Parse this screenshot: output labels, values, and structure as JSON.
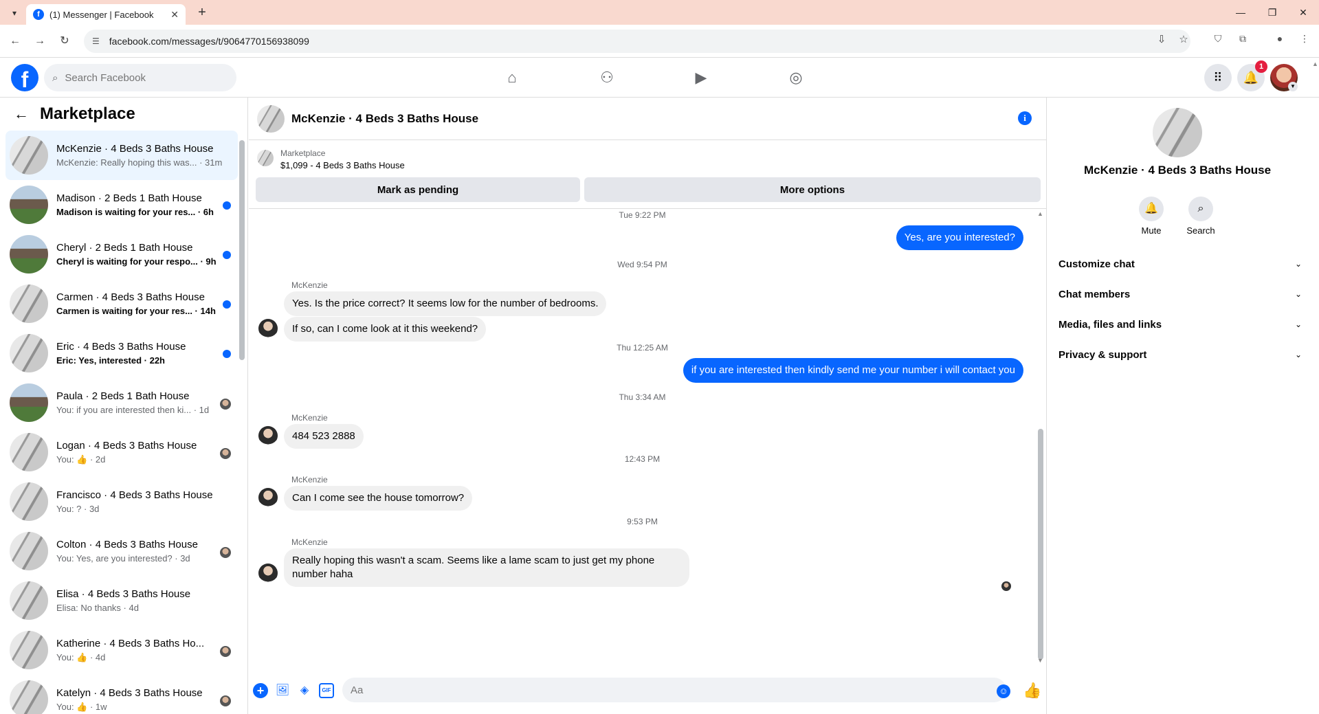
{
  "browser": {
    "tab_title": "(1) Messenger | Facebook",
    "url": "facebook.com/messages/t/9064770156938099"
  },
  "fb": {
    "search_placeholder": "Search Facebook",
    "notification_count": "1"
  },
  "sidebar": {
    "title": "Marketplace",
    "conversations": [
      {
        "name": "McKenzie · 4 Beds 3 Baths House",
        "snippet": "McKenzie: Really hoping this was... · 31m",
        "thumb": "h4",
        "active": true,
        "unread": false,
        "indicator": "none"
      },
      {
        "name": "Madison · 2 Beds 1 Bath House",
        "snippet": "Madison is waiting for your res... · 6h",
        "thumb": "h2",
        "active": false,
        "unread": true,
        "indicator": "dot"
      },
      {
        "name": "Cheryl · 2 Beds 1 Bath House",
        "snippet": "Cheryl is waiting for your respo... · 9h",
        "thumb": "h2",
        "active": false,
        "unread": true,
        "indicator": "dot"
      },
      {
        "name": "Carmen · 4 Beds 3 Baths House",
        "snippet": "Carmen is waiting for your res... · 14h",
        "thumb": "h4",
        "active": false,
        "unread": true,
        "indicator": "dot"
      },
      {
        "name": "Eric · 4 Beds 3 Baths House",
        "snippet": "Eric: Yes, interested · 22h",
        "thumb": "h4",
        "active": false,
        "unread": true,
        "indicator": "dot"
      },
      {
        "name": "Paula · 2 Beds 1 Bath House",
        "snippet": "You: if you are interested then ki... · 1d",
        "thumb": "h2",
        "active": false,
        "unread": false,
        "indicator": "seen"
      },
      {
        "name": "Logan · 4 Beds 3 Baths House",
        "snippet": "You: 👍 · 2d",
        "thumb": "h4",
        "active": false,
        "unread": false,
        "indicator": "seen"
      },
      {
        "name": "Francisco · 4 Beds 3 Baths House",
        "snippet": "You: ? · 3d",
        "thumb": "h4",
        "active": false,
        "unread": false,
        "indicator": "none"
      },
      {
        "name": "Colton · 4 Beds 3 Baths House",
        "snippet": "You: Yes, are you interested? · 3d",
        "thumb": "h4",
        "active": false,
        "unread": false,
        "indicator": "seen"
      },
      {
        "name": "Elisa · 4 Beds 3 Baths House",
        "snippet": "Elisa: No thanks · 4d",
        "thumb": "h4",
        "active": false,
        "unread": false,
        "indicator": "none"
      },
      {
        "name": "Katherine · 4 Beds 3 Baths Ho...",
        "snippet": "You: 👍 · 4d",
        "thumb": "h4",
        "active": false,
        "unread": false,
        "indicator": "seen"
      },
      {
        "name": "Katelyn · 4 Beds 3 Baths House",
        "snippet": "You: 👍 · 1w",
        "thumb": "h4",
        "active": false,
        "unread": false,
        "indicator": "seen"
      }
    ]
  },
  "chat": {
    "title": "McKenzie · 4 Beds 3 Baths House",
    "listing_source": "Marketplace",
    "listing_price": "$1,099 - 4 Beds 3 Baths House",
    "mark_pending_label": "Mark as pending",
    "more_options_label": "More options",
    "timestamps": [
      "Tue 9:22 PM",
      "Wed 9:54 PM",
      "Thu 12:25 AM",
      "Thu 3:34 AM",
      "12:43 PM",
      "9:53 PM"
    ],
    "sender_name": "McKenzie",
    "messages": {
      "out1": "Yes, are you interested?",
      "in1a": "Yes. Is the price correct? It seems low for the number of bedrooms.",
      "in1b": "If so, can I come look at it this weekend?",
      "out2": "if you are interested then kindly send me your number i will contact you",
      "in2": "484 523 2888",
      "in3": "Can I come see the house tomorrow?",
      "in4_line1": "Really hoping this wasn't a scam. Seems like a lame scam to just get my phone",
      "in4_line2": "number haha"
    },
    "composer_placeholder": "Aa",
    "gif_label": "GIF"
  },
  "details": {
    "name": "McKenzie · 4 Beds 3 Baths House",
    "mute_label": "Mute",
    "search_label": "Search",
    "sections": [
      "Customize chat",
      "Chat members",
      "Media, files and links",
      "Privacy & support"
    ]
  }
}
